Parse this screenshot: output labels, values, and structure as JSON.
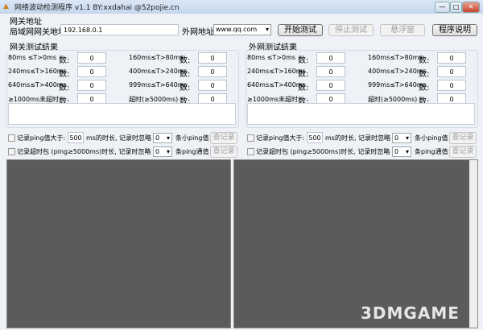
{
  "window": {
    "title": "网络波动检测程序 v1.1  BY:xxdahai  @52pojie.cn",
    "minimize": "—",
    "maximize": "□",
    "close": "✕"
  },
  "gateway": {
    "section_label": "网关地址",
    "lan_label": "局域网网关地址:",
    "lan_value": "192.168.0.1",
    "wan_label": "外网地址:",
    "wan_value": "www.qq.com"
  },
  "buttons": {
    "start": "开始测试",
    "stop": "停止测试",
    "float": "悬浮窗",
    "help": "程序说明"
  },
  "panels": [
    {
      "title": "网关测试结果",
      "count_label": "数:",
      "rows": [
        {
          "label": "80ms ≤T>0ms",
          "value": "0"
        },
        {
          "label": "160ms≤T>80ms",
          "value": "0"
        },
        {
          "label": "240ms≤T>160ms",
          "value": "0"
        },
        {
          "label": "400ms≤T>240ms",
          "value": "0"
        },
        {
          "label": "640ms≤T>400ms",
          "value": "0"
        },
        {
          "label": "999ms≤T>640ms",
          "value": "0"
        },
        {
          "label": "≥1000ms未超时",
          "value": "0"
        },
        {
          "label": "超时(≥5000ms)",
          "value": "0"
        }
      ],
      "log1": {
        "prefix": "记录ping值大于:",
        "threshold": "500",
        "middle": "ms的时长, 记录时忽略",
        "ignore": "0",
        "suffix": "条小ping值",
        "button": "查记录"
      },
      "log2": {
        "prefix": "记录超时包 (ping≥5000ms)时长, 记录时忽略",
        "ignore": "0",
        "suffix": "条ping通值",
        "button": "查记录"
      }
    },
    {
      "title": "外网测试结果",
      "count_label": "数:",
      "rows": [
        {
          "label": "80ms ≤T>0ms",
          "value": "0"
        },
        {
          "label": "160ms≤T>80ms",
          "value": "0"
        },
        {
          "label": "240ms≤T>160ms",
          "value": "0"
        },
        {
          "label": "400ms≤T>240ms",
          "value": "0"
        },
        {
          "label": "640ms≤T>400ms",
          "value": "0"
        },
        {
          "label": "999ms≤T>640ms",
          "value": "0"
        },
        {
          "label": "≥1000ms未超时",
          "value": "0"
        },
        {
          "label": "超时(≥5000ms)",
          "value": "0"
        }
      ],
      "log1": {
        "prefix": "记录ping值大于:",
        "threshold": "500",
        "middle": "ms的时长, 记录时忽略",
        "ignore": "0",
        "suffix": "条小ping值",
        "button": "查记录"
      },
      "log2": {
        "prefix": "记录超时包 (ping≥5000ms)时长, 记录时忽略",
        "ignore": "0",
        "suffix": "条ping通值",
        "button": "查记录"
      }
    }
  ],
  "watermark": "3DMGAME"
}
